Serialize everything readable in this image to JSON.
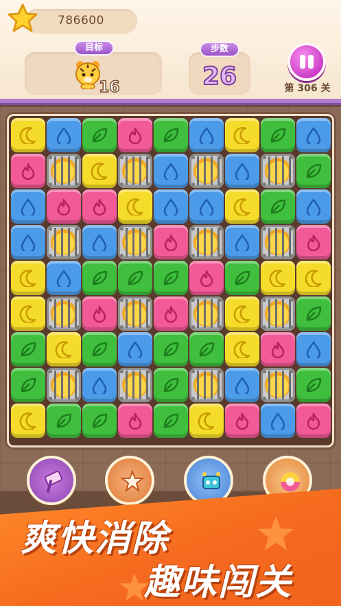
{
  "hud": {
    "score": "786600",
    "goal_label": "目标",
    "goal_count": "16",
    "steps_label": "步数",
    "steps_count": "26",
    "level_label": "第 306 关"
  },
  "board": {
    "rows": [
      [
        "yellow",
        "blue",
        "green",
        "pink",
        "green",
        "blue",
        "yellow",
        "green",
        "blue"
      ],
      [
        "pink",
        "cage",
        "yellow",
        "cage",
        "blue",
        "cage",
        "blue",
        "cage",
        "green"
      ],
      [
        "blue",
        "pink",
        "pink",
        "yellow",
        "blue",
        "blue",
        "yellow",
        "green",
        "blue"
      ],
      [
        "blue",
        "cage",
        "blue",
        "cage",
        "pink",
        "cage",
        "blue",
        "cage",
        "pink"
      ],
      [
        "yellow",
        "blue",
        "green",
        "green",
        "green",
        "pink",
        "green",
        "yellow",
        "yellow"
      ],
      [
        "yellow",
        "cage",
        "pink",
        "cage",
        "pink",
        "cage",
        "yellow",
        "cage",
        "green"
      ],
      [
        "green",
        "yellow",
        "green",
        "blue",
        "green",
        "green",
        "yellow",
        "pink",
        "blue"
      ],
      [
        "green",
        "cage",
        "blue",
        "cage",
        "green",
        "cage",
        "blue",
        "cage",
        "green"
      ],
      [
        "yellow",
        "green",
        "green",
        "pink",
        "green",
        "yellow",
        "pink",
        "blue",
        "pink"
      ]
    ],
    "colors": {
      "yellow": "#f6dc2a",
      "blue": "#4c9be8",
      "green": "#3fbf3d",
      "pink": "#f15a97"
    },
    "icons": {
      "yellow": "moon-icon",
      "blue": "drop-icon",
      "green": "leaf-icon",
      "pink": "flame-icon",
      "cage": "caged-tiger-icon"
    }
  },
  "boosters": [
    "hammer-icon",
    "star-burst-icon",
    "robot-icon",
    "rainbow-ball-icon"
  ],
  "banner": {
    "line1": "爽快消除",
    "line2": "趣味闯关"
  }
}
